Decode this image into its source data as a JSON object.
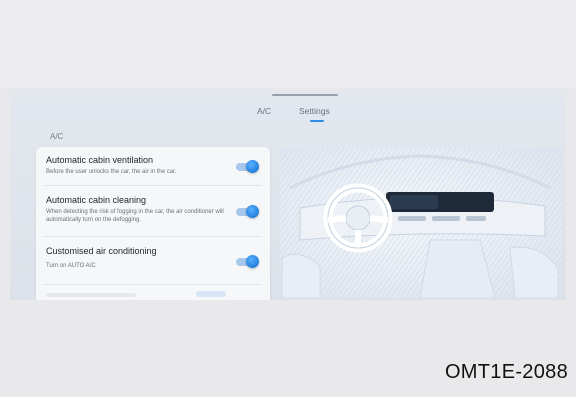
{
  "tabs": [
    {
      "label": "A/C"
    },
    {
      "label": "Settings",
      "active": true
    }
  ],
  "section_label": "A/C",
  "settings": [
    {
      "title": "Automatic cabin ventilation",
      "description": "Before the user unlocks the car, the air in the car.",
      "enabled": true
    },
    {
      "title": "Automatic cabin cleaning",
      "description": "When detecting the risk of fogging in the car, the air conditioner will automatically turn on the defogging.",
      "enabled": true
    },
    {
      "title": "Customised air conditioning",
      "description": "Turn on AUTO A/C",
      "enabled": true
    }
  ],
  "figure_code": "OMT1E-2088",
  "colors": {
    "accent": "#2d8de3",
    "toggle_track": "#a7c8ea",
    "card_bg": "#f6f7f9",
    "screen_bg": "#e0e5ec"
  },
  "icons": {
    "car_interior": "car-interior-illustration"
  }
}
